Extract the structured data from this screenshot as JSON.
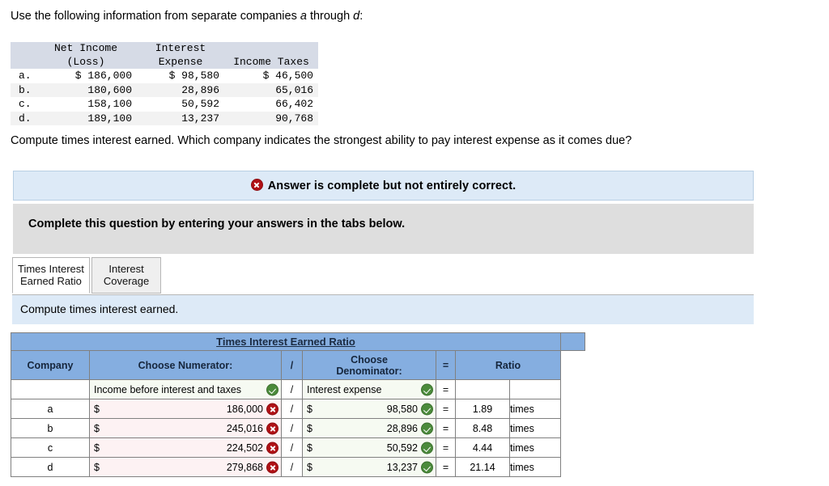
{
  "intro": {
    "text_before": "Use the following information from separate companies ",
    "italic_a": "a",
    "text_mid": " through ",
    "italic_d": "d",
    "text_after": ":"
  },
  "given_table": {
    "headers": [
      {
        "line1": "Net Income",
        "line2": "(Loss)"
      },
      {
        "line1": "Interest",
        "line2": "Expense"
      },
      {
        "line1": "",
        "line2": "Income Taxes"
      }
    ],
    "rows": [
      {
        "label": "a.",
        "net_income": "$ 186,000",
        "interest_expense": "$ 98,580",
        "income_taxes": "$ 46,500"
      },
      {
        "label": "b.",
        "net_income": "180,600",
        "interest_expense": "28,896",
        "income_taxes": "65,016"
      },
      {
        "label": "c.",
        "net_income": "158,100",
        "interest_expense": "50,592",
        "income_taxes": "66,402"
      },
      {
        "label": "d.",
        "net_income": "189,100",
        "interest_expense": "13,237",
        "income_taxes": "90,768"
      }
    ]
  },
  "question": "Compute times interest earned. Which company indicates the strongest ability to pay interest expense as it comes due?",
  "status_banner": {
    "icon": "x-circle-icon",
    "text": "Answer is complete but not entirely correct.",
    "background": "#ddeaf7",
    "icon_color": "#b01116"
  },
  "instruction_block": {
    "text": "Complete this question by entering your answers in the tabs below.",
    "background": "#dedede"
  },
  "tabs": [
    {
      "label": "Times Interest\nEarned Ratio",
      "active": true
    },
    {
      "label": "Interest\nCoverage",
      "active": false
    }
  ],
  "sub_prompt": {
    "text": "Compute times interest earned.",
    "background": "#ddeaf7"
  },
  "answer_table": {
    "title": "Times Interest Earned Ratio",
    "header_color": "#85aee0",
    "columns": {
      "company": "Company",
      "numerator": "Choose Numerator:",
      "slash": "/",
      "denominator": "Choose\nDenominator:",
      "equals": "=",
      "ratio": "Ratio"
    },
    "choice_row": {
      "company": "",
      "numerator": "Income before interest and taxes",
      "numerator_mark": "ok",
      "slash": "/",
      "denominator": "Interest expense",
      "denominator_mark": "ok",
      "equals": "=",
      "ratio": "",
      "times": ""
    },
    "rows": [
      {
        "company": "a",
        "num_currency": "$",
        "num_value": "186,000",
        "num_mark": "bad",
        "slash": "/",
        "den_currency": "$",
        "den_value": "98,580",
        "den_mark": "ok",
        "equals": "=",
        "ratio": "1.89",
        "times": "times"
      },
      {
        "company": "b",
        "num_currency": "$",
        "num_value": "245,016",
        "num_mark": "bad",
        "slash": "/",
        "den_currency": "$",
        "den_value": "28,896",
        "den_mark": "ok",
        "equals": "=",
        "ratio": "8.48",
        "times": "times"
      },
      {
        "company": "c",
        "num_currency": "$",
        "num_value": "224,502",
        "num_mark": "bad",
        "slash": "/",
        "den_currency": "$",
        "den_value": "50,592",
        "den_mark": "ok",
        "equals": "=",
        "ratio": "4.44",
        "times": "times"
      },
      {
        "company": "d",
        "num_currency": "$",
        "num_value": "279,868",
        "num_mark": "bad",
        "slash": "/",
        "den_currency": "$",
        "den_value": "13,237",
        "den_mark": "ok",
        "equals": "=",
        "ratio": "21.14",
        "times": "times"
      }
    ]
  }
}
